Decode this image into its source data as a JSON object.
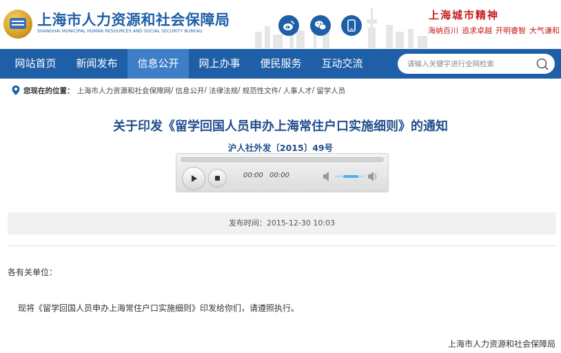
{
  "header": {
    "org_name": "上海市人力资源和社会保障局",
    "org_name_en": "SHANGHAI MUNICIPAL HUMAN RESOURCES AND SOCIAL SECURITY BUREAU",
    "social_icons": [
      "weibo-icon",
      "wechat-icon",
      "mobile-icon"
    ],
    "slogan_title": "上海城市精神",
    "slogan_items": [
      "海纳百川",
      "追求卓越",
      "开明睿智",
      "大气谦和"
    ]
  },
  "nav": {
    "items": [
      "网站首页",
      "新闻发布",
      "信息公开",
      "网上办事",
      "便民服务",
      "互动交流"
    ],
    "active_index": 2,
    "search_placeholder": "请输入关键字进行全网检索"
  },
  "breadcrumb": {
    "label": "您现在的位置：",
    "items": [
      "上海市人力资源和社会保障网",
      "信息公开",
      "法律法规",
      "规范性文件",
      "人事人才",
      "留学人员"
    ],
    "separator": "/"
  },
  "article": {
    "title": "关于印发《留学回国人员申办上海常住户口实施细则》的通知",
    "doc_number": "沪人社外发〔2015〕49号",
    "player": {
      "current_time": "00:00",
      "total_time": "00:00"
    },
    "publish_label": "发布时间：",
    "publish_time": "2015-12-30 10:03",
    "salutation": "各有关单位：",
    "body": "现将《留学回国人员申办上海常住户口实施细则》印发给你们，请遵照执行。",
    "signature": "上海市人力资源和社会保障局"
  },
  "colors": {
    "primary": "#1f5fa8",
    "nav_active": "#3e7ec6",
    "slogan_red": "#c8191c",
    "title_blue": "#1f4d8c"
  }
}
